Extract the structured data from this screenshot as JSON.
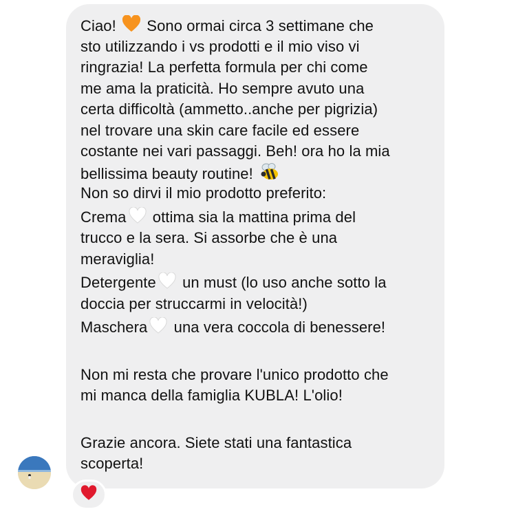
{
  "message": {
    "lines": [
      "Ciao!",
      "Sono ormai circa 3 settimane che",
      "sto utilizzando i vs prodotti e il mio viso vi",
      "ringrazia! La perfetta formula per chi come",
      "me ama la praticità. Ho sempre avuto una",
      "certa difficoltà (ammetto..anche per pigrizia)",
      "nel trovare una skin care facile ed essere",
      "costante nei vari passaggi. Beh!  ora ho la mia",
      "bellissima beauty routine!",
      "Non so dirvi il mio prodotto preferito:",
      "Crema",
      "ottima sia la mattina prima del",
      "trucco e la sera. Si assorbe che è una",
      "meraviglia!",
      "Detergente",
      "un must (lo uso anche sotto la",
      "doccia per struccarmi in velocità!)",
      "Maschera",
      "una vera coccola di benessere!",
      "Non mi resta che provare l'unico prodotto che",
      "mi manca della famiglia KUBLA! L'olio!",
      "Grazie ancora. Siete stati una fantastica",
      "scoperta!"
    ]
  },
  "icons": {
    "orange_heart": "orange-heart-icon",
    "bee": "bee-icon",
    "white_heart": "white-heart-icon",
    "reaction_heart": "red-heart-icon",
    "avatar": "avatar"
  },
  "colors": {
    "bubble": "#efeff0",
    "text": "#111111",
    "orange_heart": "#f7931e",
    "red_heart": "#e0192d"
  }
}
